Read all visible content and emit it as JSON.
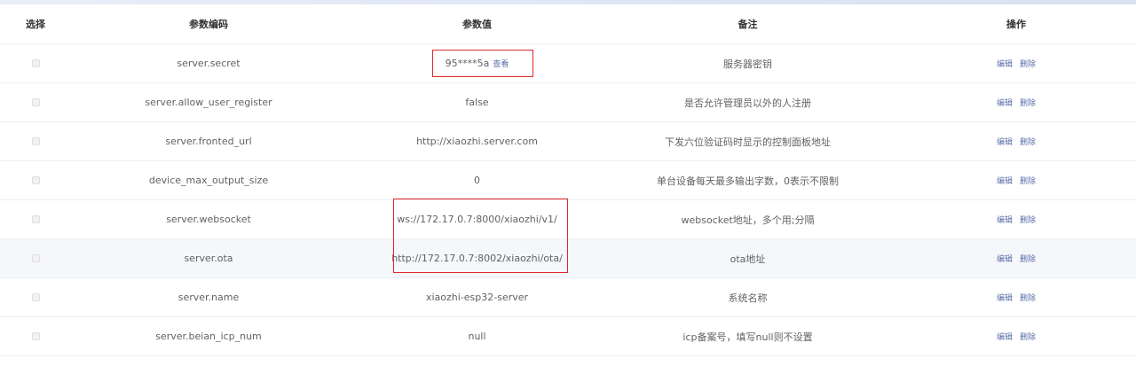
{
  "headers": {
    "select": "选择",
    "code": "参数编码",
    "value": "参数值",
    "remark": "备注",
    "ops": "操作"
  },
  "view_label": "查看",
  "edit_label": "编辑",
  "delete_label": "删除",
  "rows": [
    {
      "code": "server.secret",
      "value": "95****5a",
      "remark": "服务器密钥"
    },
    {
      "code": "server.allow_user_register",
      "value": "false",
      "remark": "是否允许管理员以外的人注册"
    },
    {
      "code": "server.fronted_url",
      "value": "http://xiaozhi.server.com",
      "remark": "下发六位验证码时显示的控制面板地址"
    },
    {
      "code": "device_max_output_size",
      "value": "0",
      "remark": "单台设备每天最多输出字数，0表示不限制"
    },
    {
      "code": "server.websocket",
      "value": "ws://172.17.0.7:8000/xiaozhi/v1/",
      "remark": "websocket地址，多个用;分隔"
    },
    {
      "code": "server.ota",
      "value": "http://172.17.0.7:8002/xiaozhi/ota/",
      "remark": "ota地址"
    },
    {
      "code": "server.name",
      "value": "xiaozhi-esp32-server",
      "remark": "系统名称"
    },
    {
      "code": "server.beian_icp_num",
      "value": "null",
      "remark": "icp备案号，填写null则不设置"
    }
  ],
  "colors": {
    "link": "#5b6fa8",
    "annotation_box": "#e02828",
    "hover_row": "#f5f7fa"
  }
}
